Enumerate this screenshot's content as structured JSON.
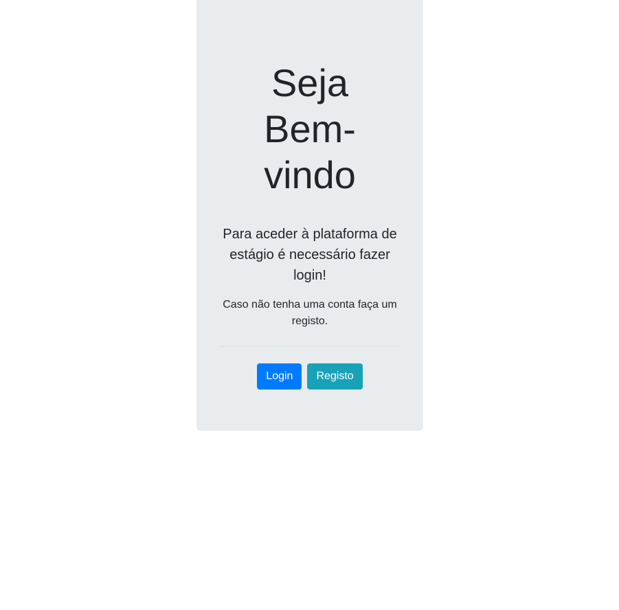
{
  "welcome": {
    "title_line1": "Seja",
    "title_line2": "Bem-",
    "title_line3": "vindo",
    "lead": "Para aceder à plataforma de estágio é necessário fazer login!",
    "subtext": "Caso não tenha uma conta faça um registo."
  },
  "actions": {
    "login_label": "Login",
    "register_label": "Registo"
  },
  "colors": {
    "card_background": "#e9ecef",
    "login_button": "#007bff",
    "register_button": "#17a2b8"
  }
}
